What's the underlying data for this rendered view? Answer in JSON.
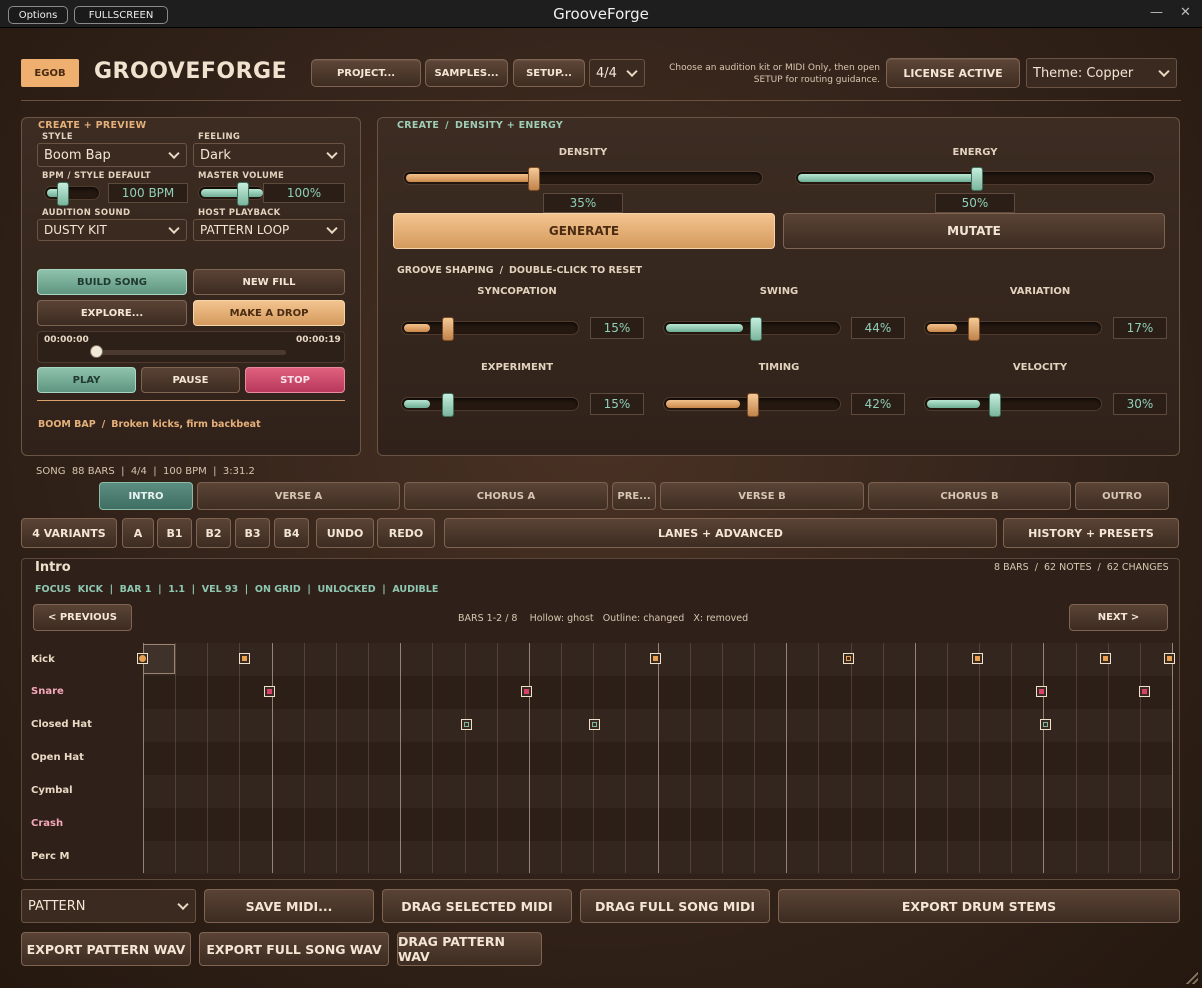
{
  "window": {
    "title": "GrooveForge",
    "options_label": "Options",
    "fullscreen_label": "FULLSCREEN",
    "minimize_glyph": "—",
    "close_glyph": "✕"
  },
  "header": {
    "logo_badge": "EGOB",
    "brand": "GROOVEFORGE",
    "project_label": "PROJECT...",
    "samples_label": "SAMPLES...",
    "setup_label": "SETUP...",
    "time_signature": "4/4",
    "hint": "Choose an audition kit or MIDI Only, then open SETUP for routing guidance.",
    "license_label": "LICENSE ACTIVE",
    "theme": "Theme: Copper"
  },
  "create_preview": {
    "title": "CREATE + PREVIEW",
    "style_label": "STYLE",
    "style_value": "Boom Bap",
    "feeling_label": "FEELING",
    "feeling_value": "Dark",
    "bpm_label": "BPM / STYLE DEFAULT",
    "bpm_value": "100 BPM",
    "bpm_level": 0.3,
    "master_label": "MASTER VOLUME",
    "master_value": "100%",
    "master_level": 1.0,
    "audition_label": "AUDITION SOUND",
    "audition_value": "DUSTY KIT",
    "host_label": "HOST PLAYBACK",
    "host_value": "PATTERN LOOP",
    "build_song": "BUILD SONG",
    "new_fill": "NEW FILL",
    "explore": "EXPLORE...",
    "make_drop": "MAKE A DROP",
    "time_start": "00:00:00",
    "time_end": "00:00:19",
    "position_level": 0.0,
    "play": "PLAY",
    "pause": "PAUSE",
    "stop": "STOP",
    "footer_style": "BOOM BAP",
    "footer_desc": "Broken kicks, firm backbeat"
  },
  "density_energy": {
    "title": "CREATE",
    "subtitle": "DENSITY + ENERGY",
    "density_label": "DENSITY",
    "density_value": "35%",
    "density_level": 0.35,
    "energy_label": "ENERGY",
    "energy_value": "50%",
    "energy_level": 0.5,
    "generate": "GENERATE",
    "mutate": "MUTATE",
    "shaping_title": "GROOVE SHAPING",
    "shaping_hint": "DOUBLE-CLICK TO RESET",
    "sliders": [
      {
        "label": "SYNCOPATION",
        "value": "15%",
        "level": 0.15,
        "color": "copper"
      },
      {
        "label": "SWING",
        "value": "44%",
        "level": 0.44,
        "color": "teal"
      },
      {
        "label": "VARIATION",
        "value": "17%",
        "level": 0.17,
        "color": "copper"
      },
      {
        "label": "EXPERIMENT",
        "value": "15%",
        "level": 0.15,
        "color": "teal"
      },
      {
        "label": "TIMING",
        "value": "42%",
        "level": 0.42,
        "color": "copper"
      },
      {
        "label": "VELOCITY",
        "value": "30%",
        "level": 0.3,
        "color": "teal"
      }
    ]
  },
  "song": {
    "info_song": "SONG",
    "info_bars": "88 BARS",
    "info_sig": "4/4",
    "info_bpm": "100 BPM",
    "info_len": "3:31.2",
    "sections": [
      "INTRO",
      "VERSE A",
      "CHORUS A",
      "PRE...",
      "VERSE B",
      "CHORUS B",
      "OUTRO"
    ],
    "active_section": "INTRO"
  },
  "toolbar": {
    "variants": "4 VARIANTS",
    "a": "A",
    "b1": "B1",
    "b2": "B2",
    "b3": "B3",
    "b4": "B4",
    "undo": "UNDO",
    "redo": "REDO",
    "lanes": "LANES + ADVANCED",
    "history": "HISTORY + PRESETS"
  },
  "pattern": {
    "title": "Intro",
    "stats": "8 BARS  /  62 NOTES  /  62 CHANGES",
    "focus": [
      "FOCUS",
      "KICK",
      "BAR 1",
      "1.1",
      "VEL 93",
      "ON GRID",
      "UNLOCKED",
      "AUDIBLE"
    ],
    "previous": "< PREVIOUS",
    "next": "NEXT >",
    "bars_text": "BARS 1-2 / 8",
    "legend_hollow": "Hollow: ghost",
    "legend_outline": "Outline: changed",
    "legend_x": "X: removed",
    "lanes": [
      "Kick",
      "Snare",
      "Closed Hat",
      "Open Hat",
      "Cymbal",
      "Crash",
      "Perc  M"
    ],
    "colors": {
      "kick": "#e9a14f",
      "snare": "#d8416b",
      "hat": "#7fb9a3"
    }
  },
  "footer": {
    "mode": "PATTERN",
    "save_midi": "SAVE MIDI...",
    "drag_selected": "DRAG SELECTED MIDI",
    "drag_full": "DRAG FULL SONG MIDI",
    "export_stems": "EXPORT DRUM STEMS",
    "export_pattern_wav": "EXPORT PATTERN WAV",
    "export_song_wav": "EXPORT FULL SONG WAV",
    "drag_pattern_wav": "DRAG PATTERN WAV"
  }
}
